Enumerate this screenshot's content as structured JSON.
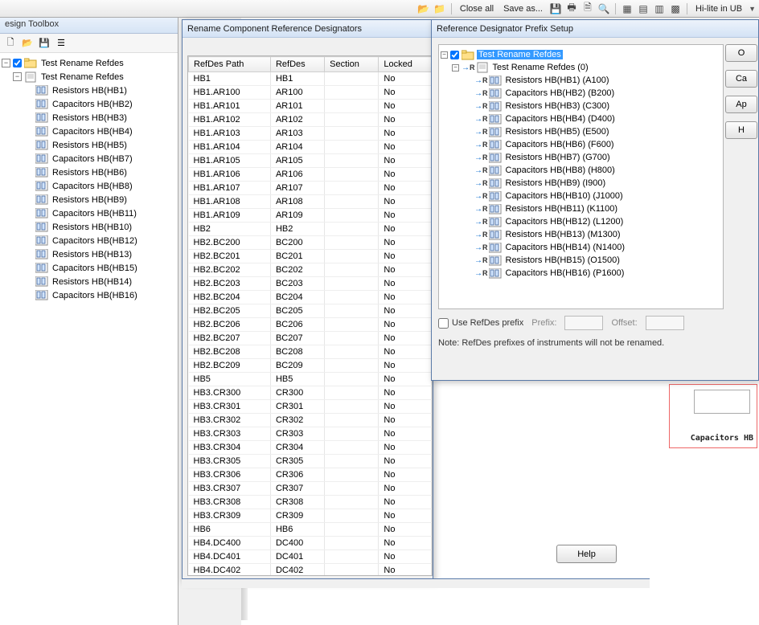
{
  "topbar": {
    "close_all": "Close all",
    "save_as": "Save as...",
    "hilite": "Hi-lite in UB"
  },
  "design_toolbox": {
    "title": "esign Toolbox",
    "root": "Test Rename Refdes",
    "doc": "Test Rename Refdes",
    "items": [
      "Resistors HB(HB1)",
      "Capacitors HB(HB2)",
      "Resistors HB(HB3)",
      "Capacitors HB(HB4)",
      "Resistors HB(HB5)",
      "Capacitors HB(HB7)",
      "Resistors HB(HB6)",
      "Capacitors HB(HB8)",
      "Resistors HB(HB9)",
      "Capacitors HB(HB11)",
      "Resistors HB(HB10)",
      "Capacitors HB(HB12)",
      "Resistors HB(HB13)",
      "Capacitors HB(HB15)",
      "Resistors HB(HB14)",
      "Capacitors HB(HB16)"
    ]
  },
  "rename_dialog": {
    "title": "Rename Component Reference Designators",
    "headers": {
      "path": "RefDes Path",
      "refdes": "RefDes",
      "section": "Section",
      "locked": "Locked"
    },
    "rows": [
      {
        "path": "HB1",
        "refdes": "HB1",
        "locked": "No"
      },
      {
        "path": "HB1.AR100",
        "refdes": "AR100",
        "locked": "No"
      },
      {
        "path": "HB1.AR101",
        "refdes": "AR101",
        "locked": "No"
      },
      {
        "path": "HB1.AR102",
        "refdes": "AR102",
        "locked": "No"
      },
      {
        "path": "HB1.AR103",
        "refdes": "AR103",
        "locked": "No"
      },
      {
        "path": "HB1.AR104",
        "refdes": "AR104",
        "locked": "No"
      },
      {
        "path": "HB1.AR105",
        "refdes": "AR105",
        "locked": "No"
      },
      {
        "path": "HB1.AR106",
        "refdes": "AR106",
        "locked": "No"
      },
      {
        "path": "HB1.AR107",
        "refdes": "AR107",
        "locked": "No"
      },
      {
        "path": "HB1.AR108",
        "refdes": "AR108",
        "locked": "No"
      },
      {
        "path": "HB1.AR109",
        "refdes": "AR109",
        "locked": "No"
      },
      {
        "path": "HB2",
        "refdes": "HB2",
        "locked": "No"
      },
      {
        "path": "HB2.BC200",
        "refdes": "BC200",
        "locked": "No"
      },
      {
        "path": "HB2.BC201",
        "refdes": "BC201",
        "locked": "No"
      },
      {
        "path": "HB2.BC202",
        "refdes": "BC202",
        "locked": "No"
      },
      {
        "path": "HB2.BC203",
        "refdes": "BC203",
        "locked": "No"
      },
      {
        "path": "HB2.BC204",
        "refdes": "BC204",
        "locked": "No"
      },
      {
        "path": "HB2.BC205",
        "refdes": "BC205",
        "locked": "No"
      },
      {
        "path": "HB2.BC206",
        "refdes": "BC206",
        "locked": "No"
      },
      {
        "path": "HB2.BC207",
        "refdes": "BC207",
        "locked": "No"
      },
      {
        "path": "HB2.BC208",
        "refdes": "BC208",
        "locked": "No"
      },
      {
        "path": "HB2.BC209",
        "refdes": "BC209",
        "locked": "No"
      },
      {
        "path": "HB5",
        "refdes": "HB5",
        "locked": "No"
      },
      {
        "path": "HB3.CR300",
        "refdes": "CR300",
        "locked": "No"
      },
      {
        "path": "HB3.CR301",
        "refdes": "CR301",
        "locked": "No"
      },
      {
        "path": "HB3.CR302",
        "refdes": "CR302",
        "locked": "No"
      },
      {
        "path": "HB3.CR303",
        "refdes": "CR303",
        "locked": "No"
      },
      {
        "path": "HB3.CR304",
        "refdes": "CR304",
        "locked": "No"
      },
      {
        "path": "HB3.CR305",
        "refdes": "CR305",
        "locked": "No"
      },
      {
        "path": "HB3.CR306",
        "refdes": "CR306",
        "locked": "No"
      },
      {
        "path": "HB3.CR307",
        "refdes": "CR307",
        "locked": "No"
      },
      {
        "path": "HB3.CR308",
        "refdes": "CR308",
        "locked": "No"
      },
      {
        "path": "HB3.CR309",
        "refdes": "CR309",
        "locked": "No"
      },
      {
        "path": "HB6",
        "refdes": "HB6",
        "locked": "No"
      },
      {
        "path": "HB4.DC400",
        "refdes": "DC400",
        "locked": "No"
      },
      {
        "path": "HB4.DC401",
        "refdes": "DC401",
        "locked": "No"
      },
      {
        "path": "HB4.DC402",
        "refdes": "DC402",
        "locked": "No"
      }
    ]
  },
  "prefix_dialog": {
    "title": "Reference Designator Prefix Setup",
    "root": "Test Rename Refdes",
    "doc": "Test Rename Refdes (0)",
    "items": [
      "Resistors HB(HB1) (A100)",
      "Capacitors HB(HB2) (B200)",
      "Resistors HB(HB3) (C300)",
      "Capacitors HB(HB4) (D400)",
      "Resistors HB(HB5) (E500)",
      "Capacitors HB(HB6) (F600)",
      "Resistors HB(HB7) (G700)",
      "Capacitors HB(HB8) (H800)",
      "Resistors HB(HB9) (I900)",
      "Capacitors HB(HB10) (J1000)",
      "Resistors HB(HB11) (K1100)",
      "Capacitors HB(HB12) (L1200)",
      "Resistors HB(HB13) (M1300)",
      "Capacitors HB(HB14) (N1400)",
      "Resistors HB(HB15) (O1500)",
      "Capacitors HB(HB16) (P1600)"
    ],
    "buttons": {
      "ok": "O",
      "cancel": "Ca",
      "apply": "Ap",
      "help_side": "H"
    },
    "use_prefix": "Use RefDes prefix",
    "prefix_label": "Prefix:",
    "offset_label": "Offset:",
    "note": "Note: RefDes prefixes of instruments will not be renamed."
  },
  "help_btn": "Help",
  "schematic_caption": "Capacitors HB"
}
